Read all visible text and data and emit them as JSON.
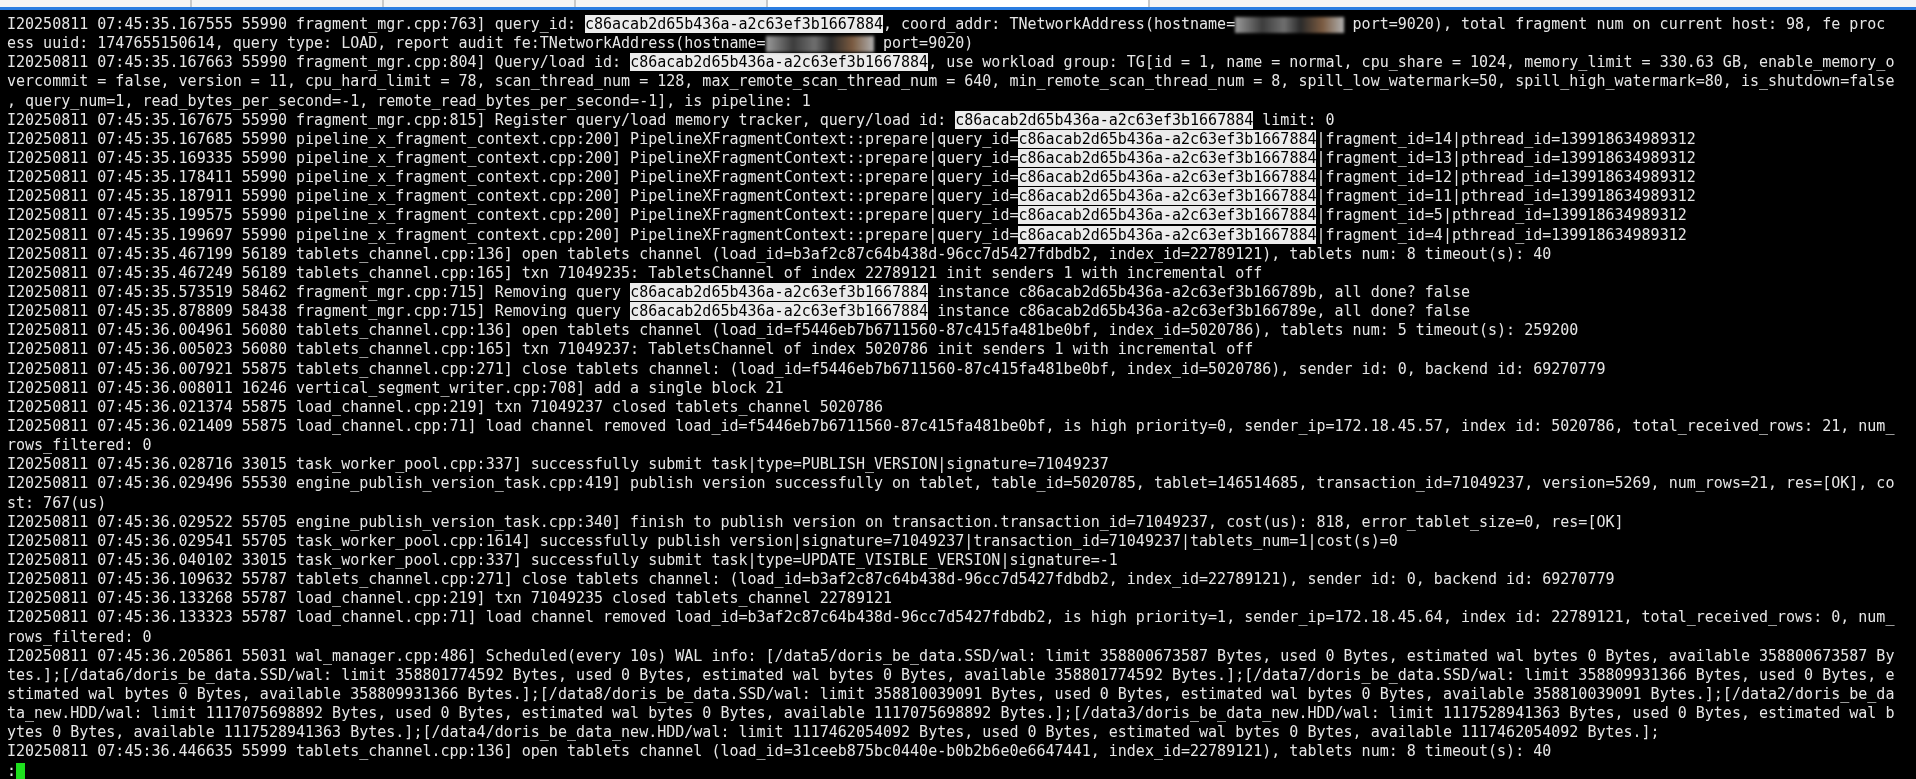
{
  "terminal": {
    "rows": [
      {
        "segments": [
          {
            "kind": "text",
            "text": "I20250811 07:45:35.167555 55990 fragment_mgr.cpp:763] query_id: "
          },
          {
            "kind": "highlight",
            "text": "c86acab2d65b436a-a2c63ef3b1667884"
          },
          {
            "kind": "text",
            "text": ", coord_addr: TNetworkAddress(hostname="
          },
          {
            "kind": "redacted"
          },
          {
            "kind": "text",
            "text": " port=9020), total fragment num on current host: 98, fe proc"
          }
        ]
      },
      {
        "segments": [
          {
            "kind": "text",
            "text": "ess uuid: 1747655150614, query type: LOAD, report audit fe:TNetworkAddress(hostname="
          },
          {
            "kind": "redacted"
          },
          {
            "kind": "text",
            "text": " port=9020)"
          }
        ]
      },
      {
        "segments": [
          {
            "kind": "text",
            "text": "I20250811 07:45:35.167663 55990 fragment_mgr.cpp:804] Query/load id: "
          },
          {
            "kind": "highlight",
            "text": "c86acab2d65b436a-a2c63ef3b1667884"
          },
          {
            "kind": "text",
            "text": ", use workload group: TG[id = 1, name = normal, cpu_share = 1024, memory_limit = 330.63 GB, enable_memory_o"
          }
        ]
      },
      {
        "segments": [
          {
            "kind": "text",
            "text": "vercommit = false, version = 11, cpu_hard_limit = 78, scan_thread_num = 128, max_remote_scan_thread_num = 640, min_remote_scan_thread_num = 8, spill_low_watermark=50, spill_high_watermark=80, is_shutdown=false"
          }
        ]
      },
      {
        "segments": [
          {
            "kind": "text",
            "text": ", query_num=1, read_bytes_per_second=-1, remote_read_bytes_per_second=-1], is pipeline: 1"
          }
        ]
      },
      {
        "segments": [
          {
            "kind": "text",
            "text": "I20250811 07:45:35.167675 55990 fragment_mgr.cpp:815] Register query/load memory tracker, query/load id: "
          },
          {
            "kind": "highlight",
            "text": "c86acab2d65b436a-a2c63ef3b1667884"
          },
          {
            "kind": "text",
            "text": " limit: 0"
          }
        ]
      },
      {
        "segments": [
          {
            "kind": "text",
            "text": "I20250811 07:45:35.167685 55990 pipeline_x_fragment_context.cpp:200] PipelineXFragmentContext::prepare|query_id="
          },
          {
            "kind": "highlight",
            "text": "c86acab2d65b436a-a2c63ef3b1667884"
          },
          {
            "kind": "text",
            "text": "|fragment_id=14|pthread_id=139918634989312"
          }
        ]
      },
      {
        "segments": [
          {
            "kind": "text",
            "text": "I20250811 07:45:35.169335 55990 pipeline_x_fragment_context.cpp:200] PipelineXFragmentContext::prepare|query_id="
          },
          {
            "kind": "highlight",
            "text": "c86acab2d65b436a-a2c63ef3b1667884"
          },
          {
            "kind": "text",
            "text": "|fragment_id=13|pthread_id=139918634989312"
          }
        ]
      },
      {
        "segments": [
          {
            "kind": "text",
            "text": "I20250811 07:45:35.178411 55990 pipeline_x_fragment_context.cpp:200] PipelineXFragmentContext::prepare|query_id="
          },
          {
            "kind": "highlight",
            "text": "c86acab2d65b436a-a2c63ef3b1667884"
          },
          {
            "kind": "text",
            "text": "|fragment_id=12|pthread_id=139918634989312"
          }
        ]
      },
      {
        "segments": [
          {
            "kind": "text",
            "text": "I20250811 07:45:35.187911 55990 pipeline_x_fragment_context.cpp:200] PipelineXFragmentContext::prepare|query_id="
          },
          {
            "kind": "highlight",
            "text": "c86acab2d65b436a-a2c63ef3b1667884"
          },
          {
            "kind": "text",
            "text": "|fragment_id=11|pthread_id=139918634989312"
          }
        ]
      },
      {
        "segments": [
          {
            "kind": "text",
            "text": "I20250811 07:45:35.199575 55990 pipeline_x_fragment_context.cpp:200] PipelineXFragmentContext::prepare|query_id="
          },
          {
            "kind": "highlight",
            "text": "c86acab2d65b436a-a2c63ef3b1667884"
          },
          {
            "kind": "text",
            "text": "|fragment_id=5|pthread_id=139918634989312"
          }
        ]
      },
      {
        "segments": [
          {
            "kind": "text",
            "text": "I20250811 07:45:35.199697 55990 pipeline_x_fragment_context.cpp:200] PipelineXFragmentContext::prepare|query_id="
          },
          {
            "kind": "highlight",
            "text": "c86acab2d65b436a-a2c63ef3b1667884"
          },
          {
            "kind": "text",
            "text": "|fragment_id=4|pthread_id=139918634989312"
          }
        ]
      },
      {
        "segments": [
          {
            "kind": "text",
            "text": "I20250811 07:45:35.467199 56189 tablets_channel.cpp:136] open tablets channel (load_id=b3af2c87c64b438d-96cc7d5427fdbdb2, index_id=22789121), tablets num: 8 timeout(s): 40"
          }
        ]
      },
      {
        "segments": [
          {
            "kind": "text",
            "text": "I20250811 07:45:35.467249 56189 tablets_channel.cpp:165] txn 71049235: TabletsChannel of index 22789121 init senders 1 with incremental off"
          }
        ]
      },
      {
        "segments": [
          {
            "kind": "text",
            "text": "I20250811 07:45:35.573519 58462 fragment_mgr.cpp:715] Removing query "
          },
          {
            "kind": "highlight",
            "text": "c86acab2d65b436a-a2c63ef3b1667884"
          },
          {
            "kind": "text",
            "text": " instance c86acab2d65b436a-a2c63ef3b166789b, all done? false"
          }
        ]
      },
      {
        "segments": [
          {
            "kind": "text",
            "text": "I20250811 07:45:35.878809 58438 fragment_mgr.cpp:715] Removing query "
          },
          {
            "kind": "highlight",
            "text": "c86acab2d65b436a-a2c63ef3b1667884"
          },
          {
            "kind": "text",
            "text": " instance c86acab2d65b436a-a2c63ef3b166789e, all done? false"
          }
        ]
      },
      {
        "segments": [
          {
            "kind": "text",
            "text": "I20250811 07:45:36.004961 56080 tablets_channel.cpp:136] open tablets channel (load_id=f5446eb7b6711560-87c415fa481be0bf, index_id=5020786), tablets num: 5 timeout(s): 259200"
          }
        ]
      },
      {
        "segments": [
          {
            "kind": "text",
            "text": "I20250811 07:45:36.005023 56080 tablets_channel.cpp:165] txn 71049237: TabletsChannel of index 5020786 init senders 1 with incremental off"
          }
        ]
      },
      {
        "segments": [
          {
            "kind": "text",
            "text": "I20250811 07:45:36.007921 55875 tablets_channel.cpp:271] close tablets channel: (load_id=f5446eb7b6711560-87c415fa481be0bf, index_id=5020786), sender id: 0, backend id: 69270779"
          }
        ]
      },
      {
        "segments": [
          {
            "kind": "text",
            "text": "I20250811 07:45:36.008011 16246 vertical_segment_writer.cpp:708] add a single block 21"
          }
        ]
      },
      {
        "segments": [
          {
            "kind": "text",
            "text": "I20250811 07:45:36.021374 55875 load_channel.cpp:219] txn 71049237 closed tablets_channel 5020786"
          }
        ]
      },
      {
        "segments": [
          {
            "kind": "text",
            "text": "I20250811 07:45:36.021409 55875 load_channel.cpp:71] load channel removed load_id=f5446eb7b6711560-87c415fa481be0bf, is high priority=0, sender_ip=172.18.45.57, index id: 5020786, total_received_rows: 21, num_"
          }
        ]
      },
      {
        "segments": [
          {
            "kind": "text",
            "text": "rows_filtered: 0"
          }
        ]
      },
      {
        "segments": [
          {
            "kind": "text",
            "text": "I20250811 07:45:36.028716 33015 task_worker_pool.cpp:337] successfully submit task|type=PUBLISH_VERSION|signature=71049237"
          }
        ]
      },
      {
        "segments": [
          {
            "kind": "text",
            "text": "I20250811 07:45:36.029496 55530 engine_publish_version_task.cpp:419] publish version successfully on tablet, table_id=5020785, tablet=146514685, transaction_id=71049237, version=5269, num_rows=21, res=[OK], co"
          }
        ]
      },
      {
        "segments": [
          {
            "kind": "text",
            "text": "st: 767(us)"
          }
        ]
      },
      {
        "segments": [
          {
            "kind": "text",
            "text": "I20250811 07:45:36.029522 55705 engine_publish_version_task.cpp:340] finish to publish version on transaction.transaction_id=71049237, cost(us): 818, error_tablet_size=0, res=[OK]"
          }
        ]
      },
      {
        "segments": [
          {
            "kind": "text",
            "text": "I20250811 07:45:36.029541 55705 task_worker_pool.cpp:1614] successfully publish version|signature=71049237|transaction_id=71049237|tablets_num=1|cost(s)=0"
          }
        ]
      },
      {
        "segments": [
          {
            "kind": "text",
            "text": "I20250811 07:45:36.040102 33015 task_worker_pool.cpp:337] successfully submit task|type=UPDATE_VISIBLE_VERSION|signature=-1"
          }
        ]
      },
      {
        "segments": [
          {
            "kind": "text",
            "text": "I20250811 07:45:36.109632 55787 tablets_channel.cpp:271] close tablets channel: (load_id=b3af2c87c64b438d-96cc7d5427fdbdb2, index_id=22789121), sender id: 0, backend id: 69270779"
          }
        ]
      },
      {
        "segments": [
          {
            "kind": "text",
            "text": "I20250811 07:45:36.133268 55787 load_channel.cpp:219] txn 71049235 closed tablets_channel 22789121"
          }
        ]
      },
      {
        "segments": [
          {
            "kind": "text",
            "text": "I20250811 07:45:36.133323 55787 load_channel.cpp:71] load channel removed load_id=b3af2c87c64b438d-96cc7d5427fdbdb2, is high priority=1, sender_ip=172.18.45.64, index id: 22789121, total_received_rows: 0, num_"
          }
        ]
      },
      {
        "segments": [
          {
            "kind": "text",
            "text": "rows_filtered: 0"
          }
        ]
      },
      {
        "segments": [
          {
            "kind": "text",
            "text": "I20250811 07:45:36.205861 55031 wal_manager.cpp:486] Scheduled(every 10s) WAL info: [/data5/doris_be_data.SSD/wal: limit 358800673587 Bytes, used 0 Bytes, estimated wal bytes 0 Bytes, available 358800673587 By"
          }
        ]
      },
      {
        "segments": [
          {
            "kind": "text",
            "text": "tes.];[/data6/doris_be_data.SSD/wal: limit 358801774592 Bytes, used 0 Bytes, estimated wal bytes 0 Bytes, available 358801774592 Bytes.];[/data7/doris_be_data.SSD/wal: limit 358809931366 Bytes, used 0 Bytes, e"
          }
        ]
      },
      {
        "segments": [
          {
            "kind": "text",
            "text": "stimated wal bytes 0 Bytes, available 358809931366 Bytes.];[/data8/doris_be_data.SSD/wal: limit 358810039091 Bytes, used 0 Bytes, estimated wal bytes 0 Bytes, available 358810039091 Bytes.];[/data2/doris_be_da"
          }
        ]
      },
      {
        "segments": [
          {
            "kind": "text",
            "text": "ta_new.HDD/wal: limit 1117075698892 Bytes, used 0 Bytes, estimated wal bytes 0 Bytes, available 1117075698892 Bytes.];[/data3/doris_be_data_new.HDD/wal: limit 1117528941363 Bytes, used 0 Bytes, estimated wal b"
          }
        ]
      },
      {
        "segments": [
          {
            "kind": "text",
            "text": "ytes 0 Bytes, available 1117528941363 Bytes.];[/data4/doris_be_data_new.HDD/wal: limit 1117462054092 Bytes, used 0 Bytes, estimated wal bytes 0 Bytes, available 1117462054092 Bytes.];"
          }
        ]
      },
      {
        "segments": [
          {
            "kind": "text",
            "text": "I20250811 07:45:36.446635 55999 tablets_channel.cpp:136] open tablets channel (load_id=31ceeb875bc0440e-b0b2b6e0e6647441, index_id=22789121), tablets num: 8 timeout(s): 40"
          }
        ]
      },
      {
        "segments": [
          {
            "kind": "text",
            "text": ":"
          },
          {
            "kind": "cursor"
          }
        ]
      }
    ]
  }
}
